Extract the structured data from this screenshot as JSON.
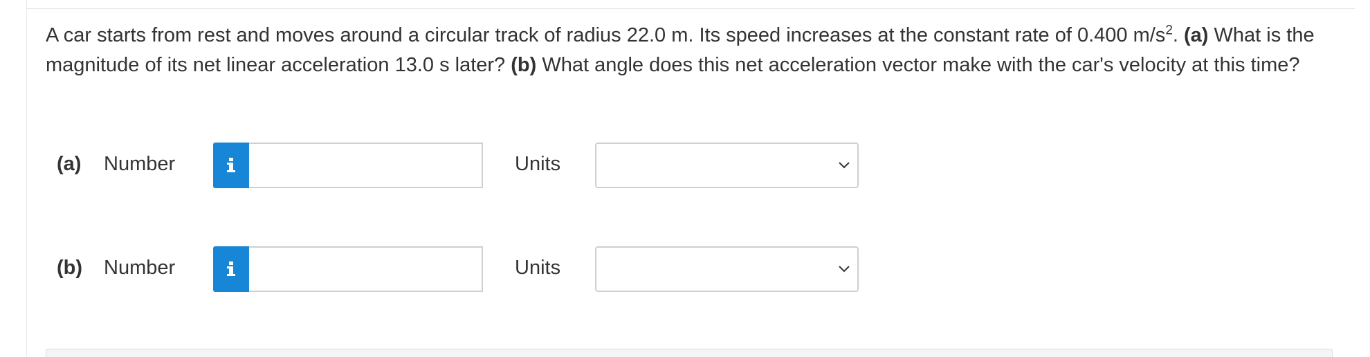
{
  "question": {
    "text_1": "A car starts from rest and moves around a circular track of radius 22.0 m. Its speed increases at the constant rate of 0.400 m/s",
    "superscript": "2",
    "text_2": ". ",
    "part_a_tag": "(a)",
    "text_3": " What is the magnitude of its net linear acceleration 13.0 s later? ",
    "part_b_tag": "(b)",
    "text_4": " What angle does this net acceleration vector make with the car's velocity at this time?"
  },
  "answers": [
    {
      "part_label": "(a)",
      "number_label": "Number",
      "number_value": "",
      "units_label": "Units",
      "units_value": ""
    },
    {
      "part_label": "(b)",
      "number_label": "Number",
      "number_value": "",
      "units_label": "Units",
      "units_value": ""
    }
  ],
  "icons": {
    "info": "info-icon",
    "dropdown": "chevron-down-icon"
  },
  "colors": {
    "accent": "#1886d6",
    "text": "#333333",
    "border": "#cfcfcf"
  }
}
